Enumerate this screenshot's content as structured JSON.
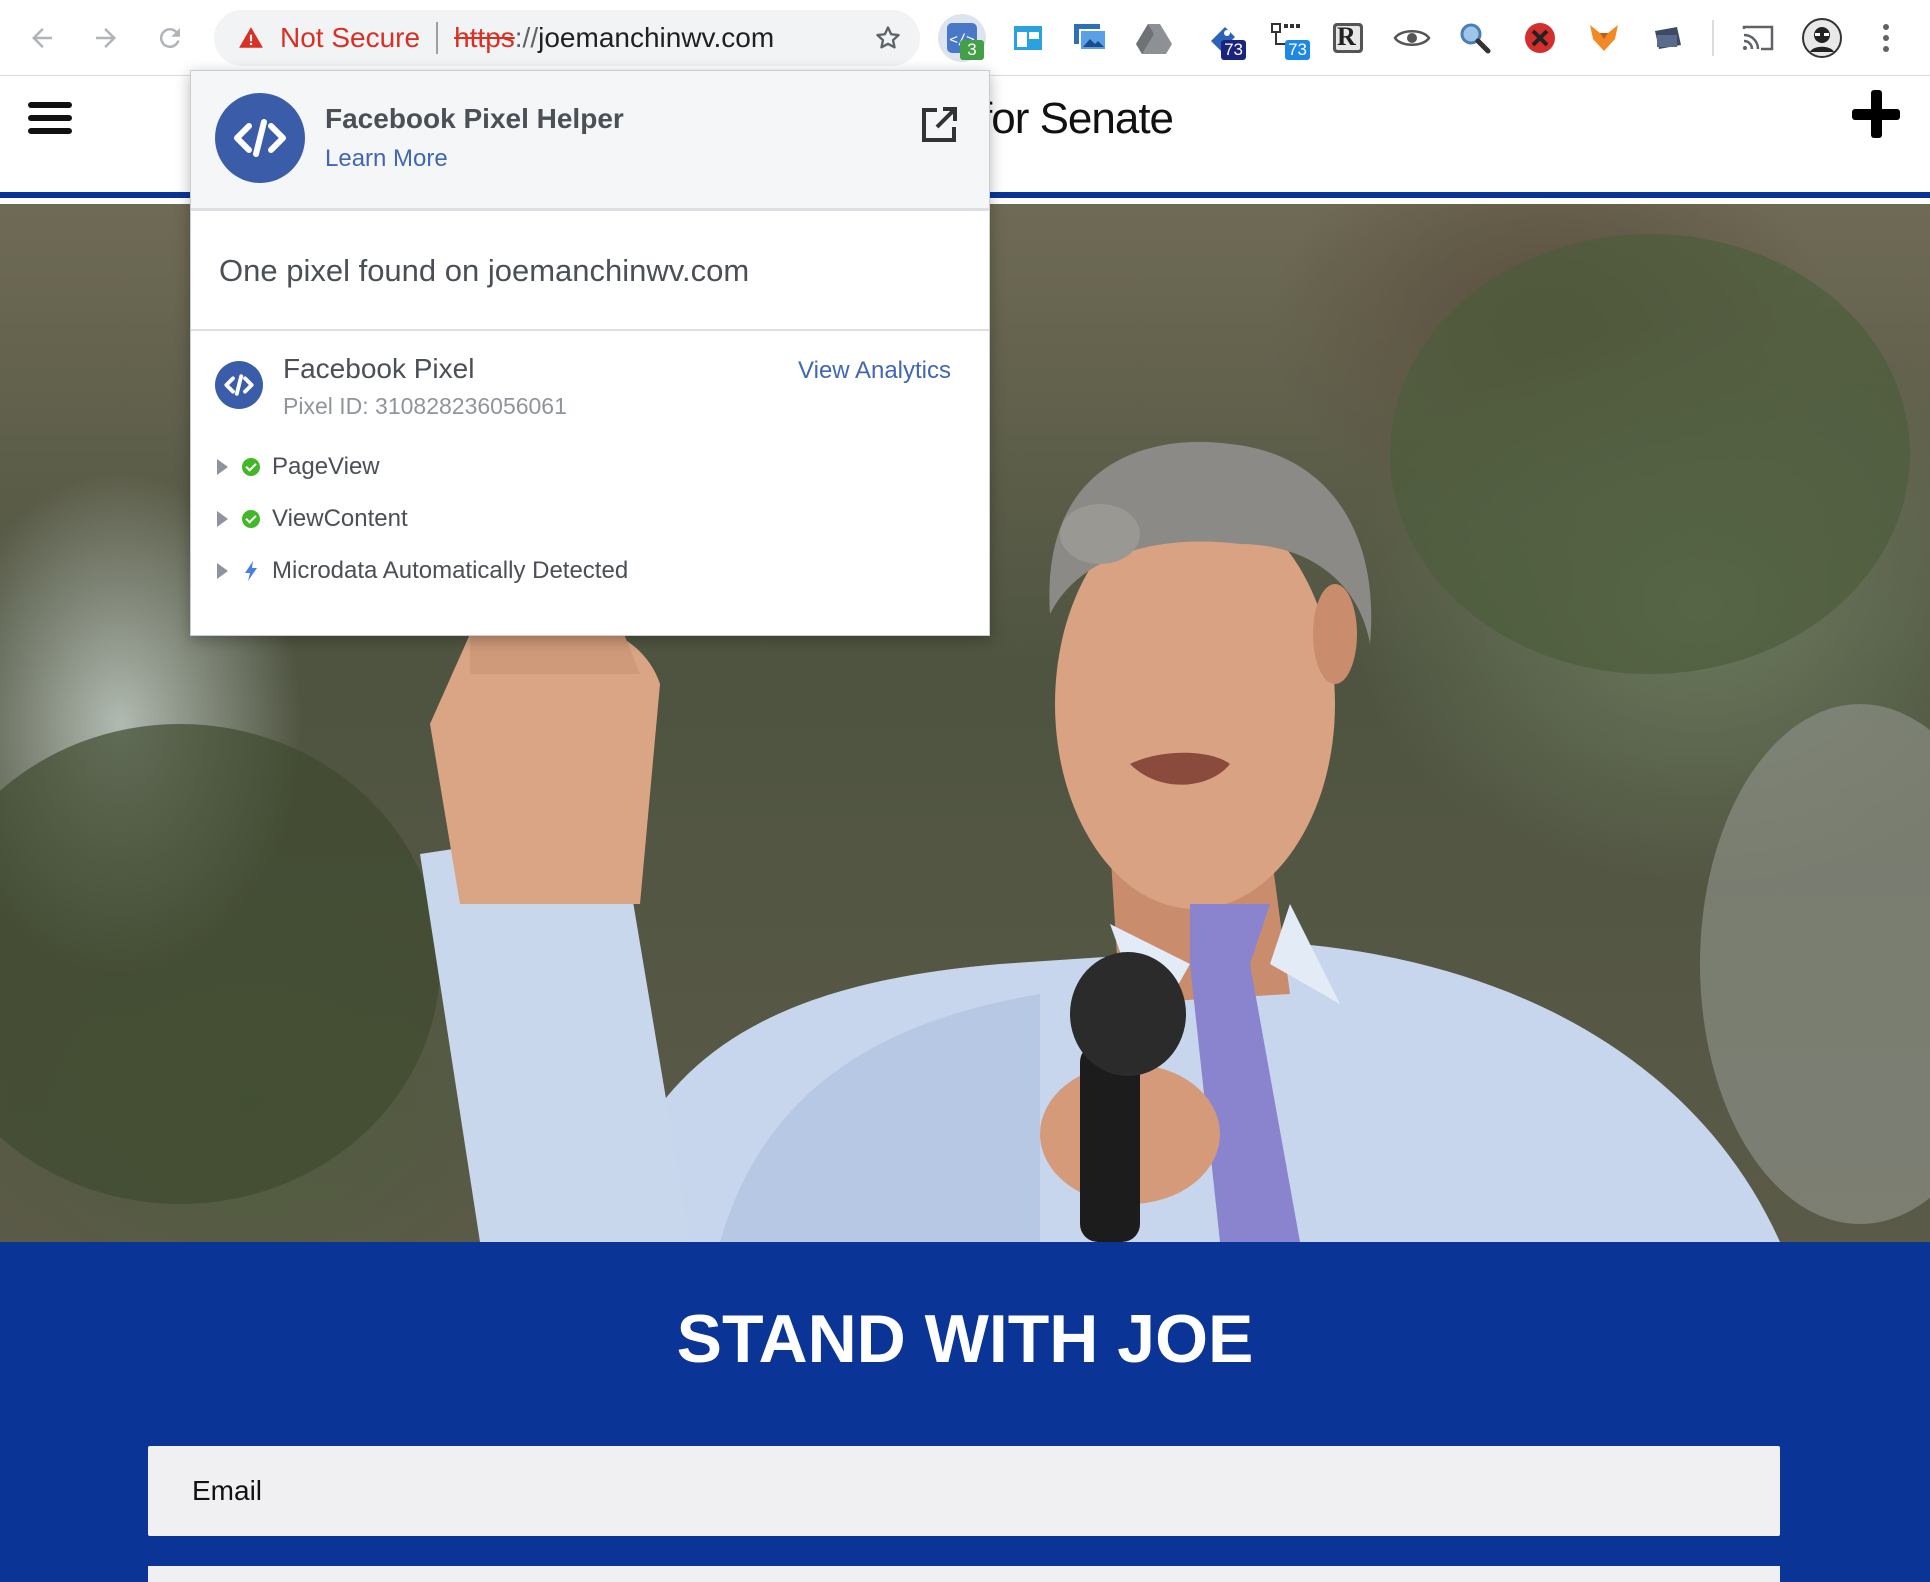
{
  "browser": {
    "omnibox": {
      "security_label": "Not Secure",
      "scheme": "https",
      "slashes": "://",
      "host": "joemanchinwv.com"
    },
    "extensions": [
      {
        "name": "pixel-helper-ext-icon",
        "badge": "3",
        "badge_color": "#43a047"
      },
      {
        "name": "screen-window-ext-icon"
      },
      {
        "name": "photos-ext-icon"
      },
      {
        "name": "drive-ext-icon"
      },
      {
        "name": "pin-ext-icon",
        "badge": "73",
        "badge_color": "#1a237e"
      },
      {
        "name": "network-ext-icon",
        "badge": "73",
        "badge_color": "#1e88e5"
      },
      {
        "name": "r-ext-icon",
        "letter": "R"
      },
      {
        "name": "eye-ext-icon"
      },
      {
        "name": "magnifier-ext-icon"
      },
      {
        "name": "block-ext-icon"
      },
      {
        "name": "fox-ext-icon"
      },
      {
        "name": "folder-ext-icon"
      }
    ]
  },
  "site": {
    "title": "for Senate"
  },
  "pixel_helper": {
    "title": "Facebook Pixel Helper",
    "learn_more": "Learn More",
    "summary": "One pixel found on joemanchinwv.com",
    "pixel": {
      "name": "Facebook Pixel",
      "id_text": "Pixel ID: 310828236056061",
      "analytics_link": "View Analytics",
      "events": [
        {
          "label": "PageView",
          "status": "success"
        },
        {
          "label": "ViewContent",
          "status": "success"
        },
        {
          "label": "Microdata Automatically Detected",
          "status": "auto"
        }
      ]
    }
  },
  "signup": {
    "heading": "STAND WITH JOE",
    "email_placeholder": "Email"
  },
  "colors": {
    "brand_blue": "#0a3596",
    "fb_blue": "#3b5da9",
    "link_blue": "#4267b2",
    "warning_red": "#d93025",
    "success_green": "#42b72a"
  }
}
